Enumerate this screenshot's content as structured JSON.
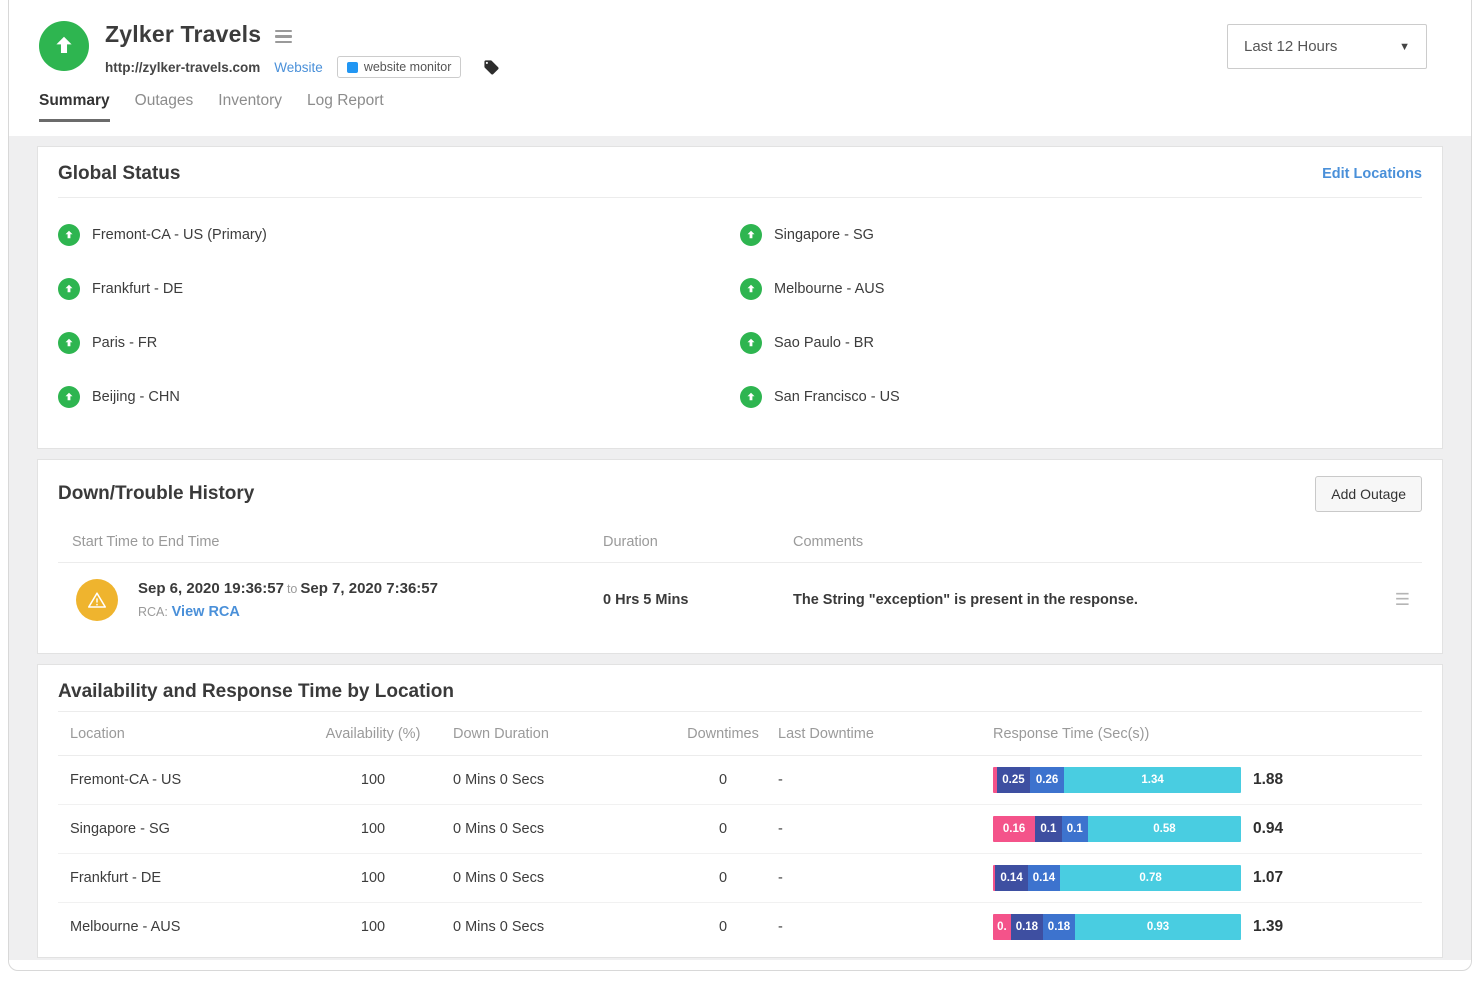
{
  "header": {
    "title": "Zylker Travels",
    "url": "http://zylker-travels.com",
    "website_link": "Website",
    "monitor_badge": "website monitor",
    "time_range": "Last 12 Hours",
    "tabs": [
      {
        "label": "Summary",
        "active": true
      },
      {
        "label": "Outages",
        "active": false
      },
      {
        "label": "Inventory",
        "active": false
      },
      {
        "label": "Log Report",
        "active": false
      }
    ]
  },
  "global_status": {
    "title": "Global Status",
    "edit_link": "Edit Locations",
    "locations": [
      {
        "name": "Fremont-CA - US (Primary)",
        "status": "up"
      },
      {
        "name": "Singapore - SG",
        "status": "up"
      },
      {
        "name": "Frankfurt - DE",
        "status": "up"
      },
      {
        "name": "Melbourne - AUS",
        "status": "up"
      },
      {
        "name": "Paris - FR",
        "status": "up"
      },
      {
        "name": "Sao Paulo - BR",
        "status": "up"
      },
      {
        "name": "Beijing - CHN",
        "status": "up"
      },
      {
        "name": "San Francisco - US",
        "status": "up"
      }
    ]
  },
  "down_history": {
    "title": "Down/Trouble History",
    "add_button": "Add Outage",
    "columns": [
      "Start Time to End Time",
      "Duration",
      "Comments"
    ],
    "rows": [
      {
        "status": "trouble",
        "start": "Sep 6, 2020 19:36:57",
        "to": "to",
        "end": "Sep 7, 2020 7:36:57",
        "rca_label": "RCA:",
        "rca_link": "View RCA",
        "duration": "0 Hrs 5 Mins",
        "comment": "The String \"exception\" is present in the response."
      }
    ]
  },
  "availability": {
    "title": "Availability and Response Time by Location",
    "columns": [
      "Location",
      "Availability (%)",
      "Down Duration",
      "Downtimes",
      "Last Downtime",
      "Response Time (Sec(s))"
    ],
    "rows": [
      {
        "location": "Fremont-CA - US",
        "availability": "100",
        "down_duration": "0 Mins 0 Secs",
        "downtimes": "0",
        "last_downtime": "-",
        "total": "1.88",
        "segments": [
          {
            "value": 0.03,
            "label": ""
          },
          {
            "value": 0.25,
            "label": "0.25"
          },
          {
            "value": 0.26,
            "label": "0.26"
          },
          {
            "value": 1.34,
            "label": "1.34"
          }
        ]
      },
      {
        "location": "Singapore - SG",
        "availability": "100",
        "down_duration": "0 Mins 0 Secs",
        "downtimes": "0",
        "last_downtime": "-",
        "total": "0.94",
        "segments": [
          {
            "value": 0.16,
            "label": "0.16"
          },
          {
            "value": 0.1,
            "label": "0.1"
          },
          {
            "value": 0.1,
            "label": "0.1"
          },
          {
            "value": 0.58,
            "label": "0.58"
          }
        ]
      },
      {
        "location": "Frankfurt - DE",
        "availability": "100",
        "down_duration": "0 Mins 0 Secs",
        "downtimes": "0",
        "last_downtime": "-",
        "total": "1.07",
        "segments": [
          {
            "value": 0.01,
            "label": ""
          },
          {
            "value": 0.14,
            "label": "0.14"
          },
          {
            "value": 0.14,
            "label": "0.14"
          },
          {
            "value": 0.78,
            "label": "0.78"
          }
        ]
      },
      {
        "location": "Melbourne - AUS",
        "availability": "100",
        "down_duration": "0 Mins 0 Secs",
        "downtimes": "0",
        "last_downtime": "-",
        "total": "1.39",
        "segments": [
          {
            "value": 0.1,
            "label": "0."
          },
          {
            "value": 0.18,
            "label": "0.18"
          },
          {
            "value": 0.18,
            "label": "0.18"
          },
          {
            "value": 0.93,
            "label": "0.93"
          }
        ]
      }
    ]
  },
  "colors": {
    "up_green": "#2eb550",
    "trouble_amber": "#efb42e",
    "link_blue": "#4a90d9",
    "badge_blue": "#2196f3",
    "segment_palette": [
      "#f4538a",
      "#3e4fa1",
      "#3d73ce",
      "#49cde1"
    ]
  }
}
